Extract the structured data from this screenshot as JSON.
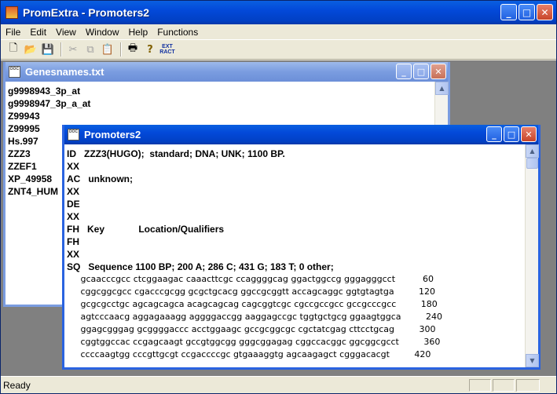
{
  "app": {
    "title": "PromExtra - Promoters2",
    "menu": [
      "File",
      "Edit",
      "View",
      "Window",
      "Help",
      "Functions"
    ],
    "toolbar": {
      "ext_label_1": "EXT",
      "ext_label_2": "RACT"
    },
    "status": "Ready"
  },
  "genesnames": {
    "title": "Genesnames.txt",
    "lines": [
      "g9998943_3p_at",
      "g9998947_3p_a_at",
      "Z99943",
      "Z99995",
      "Hs.997",
      "ZZZ3",
      "ZZEF1",
      "XP_49958",
      "ZNT4_HUM"
    ]
  },
  "promoters": {
    "title": "Promoters2",
    "lines": [
      "ID   ZZZ3(HUGO);  standard; DNA; UNK; 1100 BP.",
      "XX",
      "AC   unknown;",
      "XX",
      "DE",
      "XX",
      "FH   Key             Location/Qualifiers",
      "FH",
      "XX",
      "SQ   Sequence 1100 BP; 200 A; 286 C; 431 G; 183 T; 0 other;"
    ],
    "sequence": [
      "     gcaacccgcc ctcggaagac caaacttcgc ccaggggcag ggactggccg gggagggcct          60",
      "     cggcggcgcc cgacccgcgg gcgctgcacg ggccgcggtt accagcaggc ggtgtagtga         120",
      "     gcgcgcctgc agcagcagca acagcagcag cagcggtcgc cgccgccgcc gccgcccgcc         180",
      "     agtcccaacg aggagaaagg aggggaccgg aaggagccgc tggtgctgcg ggaagtggca         240",
      "     ggagcgggag gcggggaccc acctggaagc gccgcggcgc cgctatcgag cttcctgcag         300",
      "     cggtggccac ccgagcaagt gccgtggcgg gggcggagag cggccacggc ggcggcgcct         360",
      "     ccccaagtgg cccgttgcgt ccgaccccgc gtgaaaggtg agcaagagct cgggacacgt         420"
    ]
  }
}
